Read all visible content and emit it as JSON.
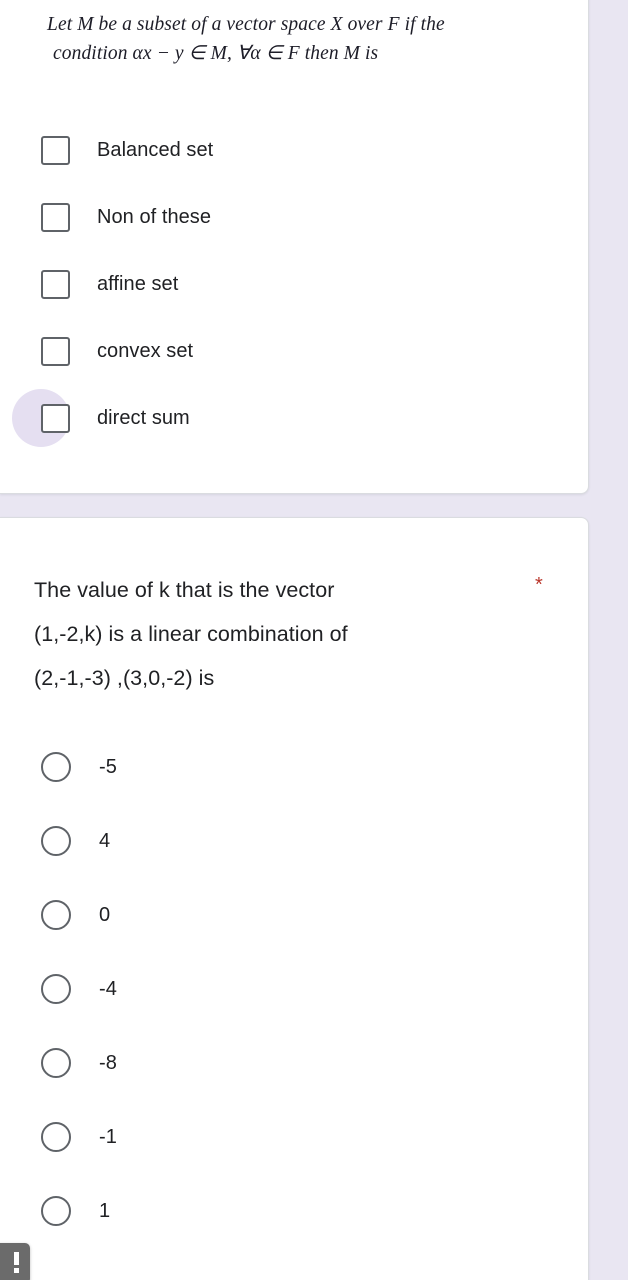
{
  "theme": {
    "page_background": "#e9e6f2",
    "card_background": "#ffffff",
    "text_color": "#202124",
    "control_color": "#5f6368",
    "required_asterisk_color": "#b9352a",
    "ripple_color": "#e5dff1"
  },
  "questions": [
    {
      "id": "q1",
      "type": "checkbox",
      "title_lines": [
        "Let M be a subset of a vector space  X over F if the",
        "condition αx − y ∈ M, ∀α ∈ F  then M  is"
      ],
      "required": false,
      "options": [
        {
          "label": "Balanced set",
          "selected": false,
          "focused": false
        },
        {
          "label": "Non of these",
          "selected": false,
          "focused": false
        },
        {
          "label": "affine set",
          "selected": false,
          "focused": false
        },
        {
          "label": "convex set",
          "selected": false,
          "focused": false
        },
        {
          "label": "direct sum",
          "selected": false,
          "focused": true
        }
      ]
    },
    {
      "id": "q2",
      "type": "radio",
      "title_lines": [
        "The value of k that is the vector",
        "(1,-2,k) is a linear combination of",
        "(2,-1,-3) ,(3,0,-2) is"
      ],
      "required": true,
      "required_marker": "*",
      "options": [
        {
          "label": "-5",
          "selected": false
        },
        {
          "label": "4",
          "selected": false
        },
        {
          "label": "0",
          "selected": false
        },
        {
          "label": "-4",
          "selected": false
        },
        {
          "label": "-8",
          "selected": false
        },
        {
          "label": "-1",
          "selected": false
        },
        {
          "label": "1",
          "selected": false
        }
      ]
    }
  ],
  "toast": {
    "icon": "error-exclamation-icon",
    "visible": true
  }
}
